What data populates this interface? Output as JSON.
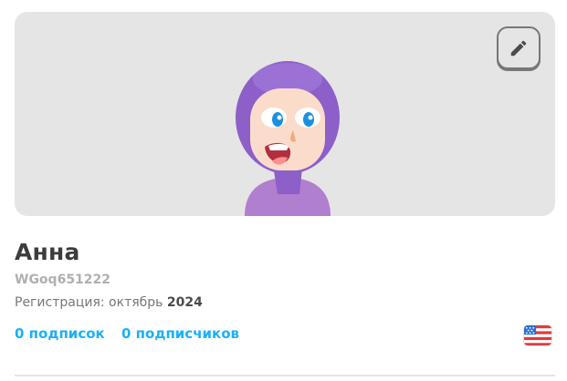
{
  "profile": {
    "name": "Анна",
    "username": "WGoq651222",
    "joined_label": "Регистрация: октябрь ",
    "joined_year": "2024",
    "following": "0 подписок",
    "followers": "0 подписчиков"
  },
  "icons": {
    "edit": "pencil-icon",
    "country_flag": "us-flag-icon"
  },
  "colors": {
    "link": "#1cb0f6",
    "banner_bg": "#e5e5e5",
    "avatar_hood": "#8c5fc9",
    "avatar_body": "#b07fcf"
  }
}
